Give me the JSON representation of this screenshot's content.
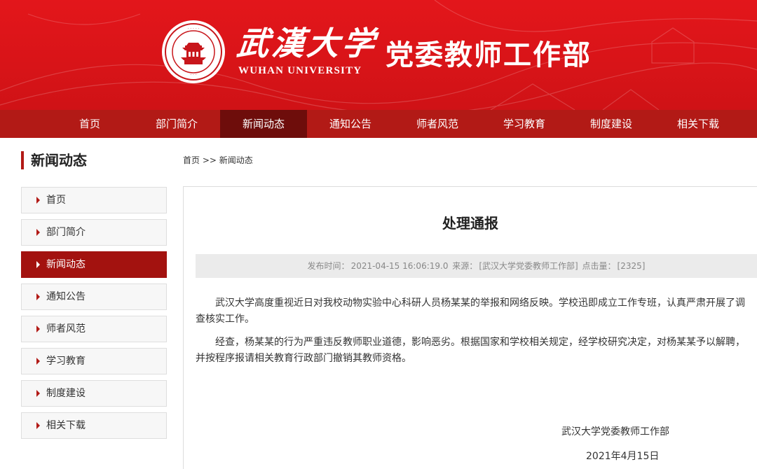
{
  "header": {
    "logo_calligraphy": "武漢大学",
    "logo_en": "WUHAN UNIVERSITY",
    "site_title": "党委教师工作部"
  },
  "nav": {
    "items": [
      "首页",
      "部门简介",
      "新闻动态",
      "通知公告",
      "师者风范",
      "学习教育",
      "制度建设",
      "相关下载"
    ],
    "active": "新闻动态"
  },
  "sidebar": {
    "title": "新闻动态",
    "items": [
      "首页",
      "部门简介",
      "新闻动态",
      "通知公告",
      "师者风范",
      "学习教育",
      "制度建设",
      "相关下载"
    ],
    "active": "新闻动态"
  },
  "breadcrumb": {
    "home": "首页",
    "separator": ">>",
    "current": "新闻动态"
  },
  "article": {
    "title": "处理通报",
    "meta": {
      "publish_label": "发布时间：",
      "publish_time": "2021-04-15 16:06:19.0",
      "source_label": "来源：",
      "source": "[武汉大学党委教师工作部]",
      "views_label": "点击量：",
      "views": "[2325]"
    },
    "paragraphs": [
      "武汉大学高度重视近日对我校动物实验中心科研人员杨某某的举报和网络反映。学校迅即成立工作专班，认真严肃开展了调查核实工作。",
      "经查，杨某某的行为严重违反教师职业道德，影响恶劣。根据国家和学校相关规定，经学校研究决定，对杨某某予以解聘，并按程序报请相关教育行政部门撤销其教师资格。"
    ],
    "sign_org": "武汉大学党委教师工作部",
    "sign_date": "2021年4月15日"
  },
  "colors": {
    "header_red": "#d81418",
    "nav_red": "#b21a16",
    "nav_active": "#6e0d0b",
    "side_active": "#a3120f"
  }
}
